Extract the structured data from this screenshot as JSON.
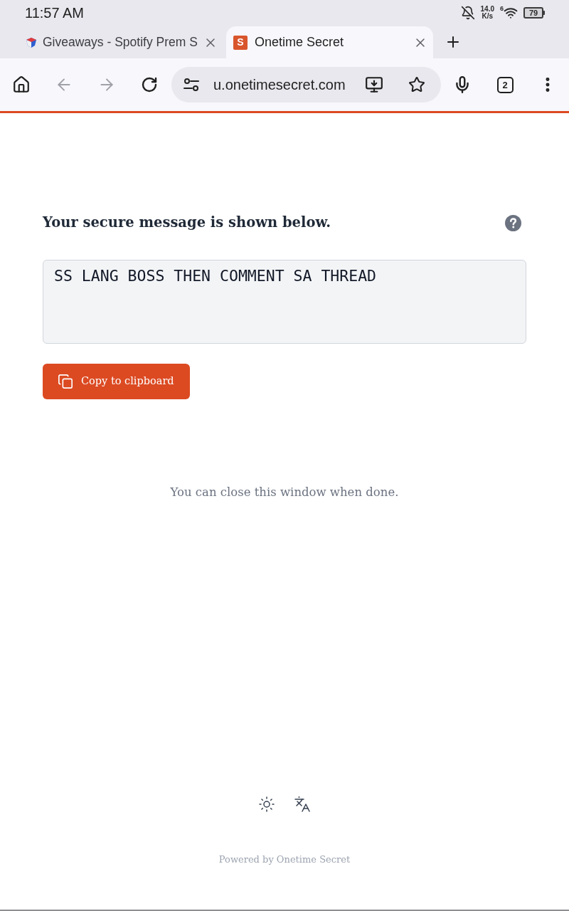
{
  "status_bar": {
    "time": "11:57 AM",
    "network_speed": "14.0",
    "network_speed_unit": "K/s",
    "wifi_badge": "6",
    "battery": "79"
  },
  "tabs": [
    {
      "title": "Giveaways - Spotify Prem S",
      "selected": false
    },
    {
      "title": "Onetime Secret",
      "favicon": "S",
      "selected": true
    }
  ],
  "toolbar": {
    "url": "u.onetimesecret.com",
    "tab_count": "2"
  },
  "page": {
    "heading": "Your secure message is shown below.",
    "secret": "SS LANG BOSS THEN COMMENT SA THREAD",
    "copy_button": "Copy to clipboard",
    "close_note": "You can close this window when done.",
    "footer": "Powered by Onetime Secret"
  }
}
